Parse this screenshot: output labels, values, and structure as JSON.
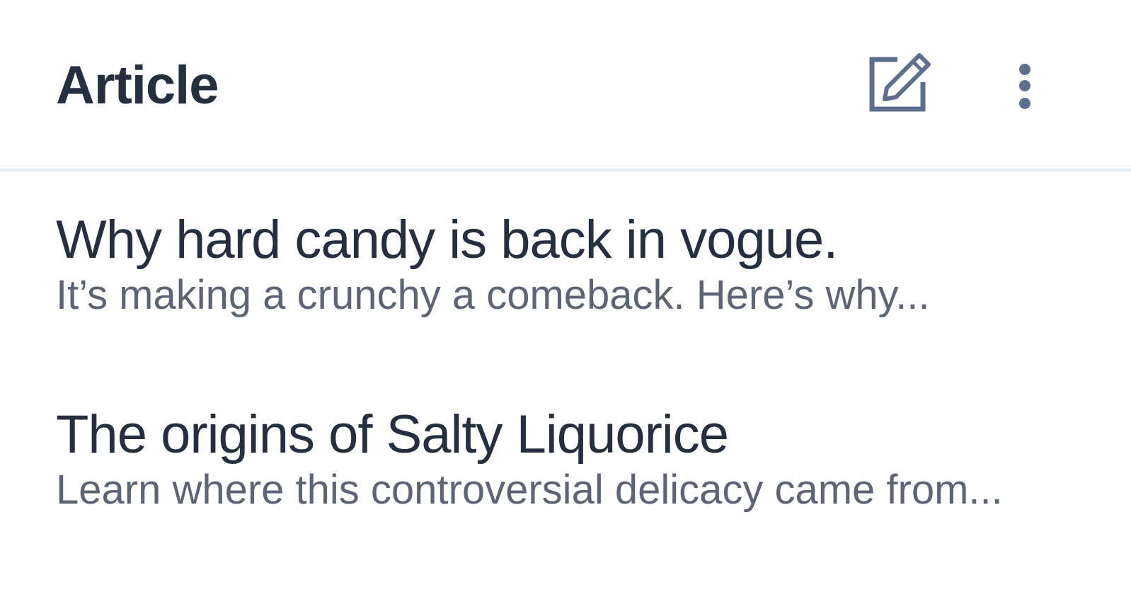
{
  "header": {
    "title": "Article",
    "edit_icon": "edit-icon",
    "more_icon": "more-vertical-icon"
  },
  "articles": [
    {
      "title": "Why hard candy is back in vogue.",
      "subtitle": "It’s making a crunchy a comeback. Here’s why..."
    },
    {
      "title": "The origins of Salty Liquorice",
      "subtitle": "Learn where this controversial delicacy came from..."
    }
  ],
  "colors": {
    "title_text": "#252f40",
    "subtitle_text": "#5d6574",
    "icon": "#5e6f8d",
    "divider": "#e2e8ee",
    "background": "#ffffff"
  }
}
